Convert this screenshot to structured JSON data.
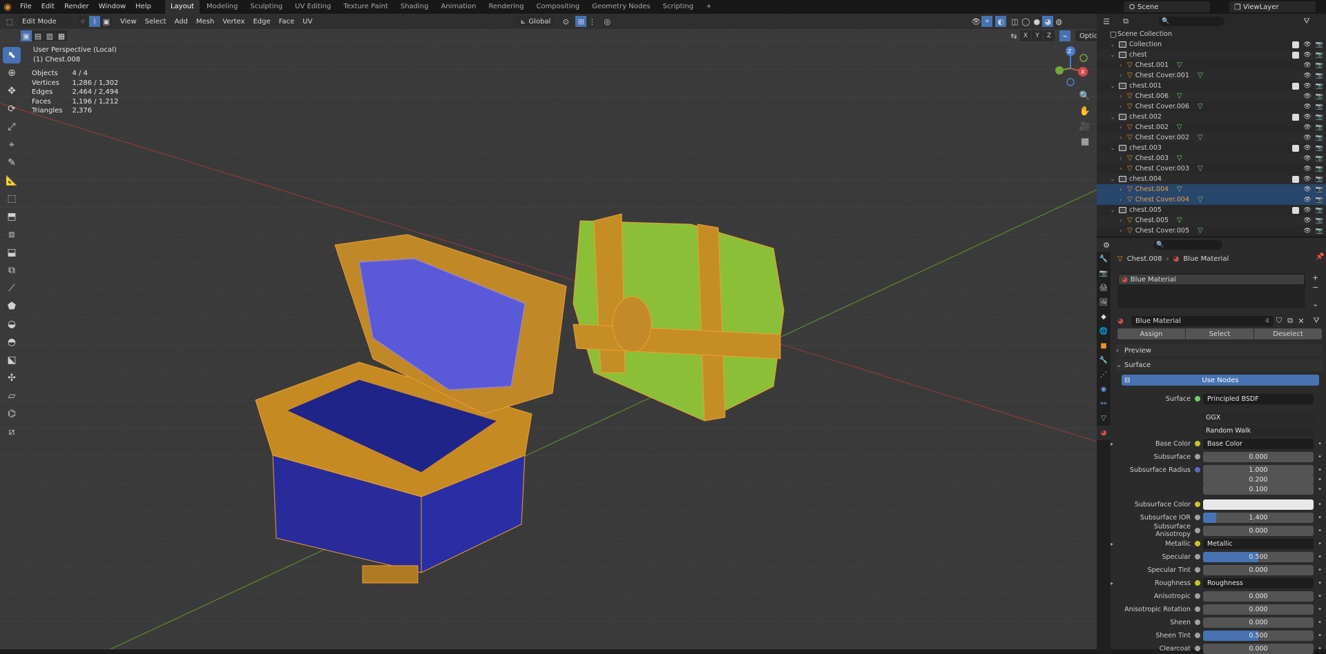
{
  "topbar": {
    "menus": [
      "File",
      "Edit",
      "Render",
      "Window",
      "Help"
    ],
    "workspaces": [
      "Layout",
      "Modeling",
      "Sculpting",
      "UV Editing",
      "Texture Paint",
      "Shading",
      "Animation",
      "Rendering",
      "Compositing",
      "Geometry Nodes",
      "Scripting"
    ],
    "active_workspace": "Layout",
    "add_tab": "+",
    "scene": "Scene",
    "view_layer": "ViewLayer"
  },
  "viewport_header": {
    "mode": "Edit Mode",
    "menus": [
      "View",
      "Select",
      "Add",
      "Mesh",
      "Vertex",
      "Edge",
      "Face",
      "UV"
    ],
    "orientation": "Global",
    "options": "Options",
    "axes": [
      "X",
      "Y",
      "Z"
    ]
  },
  "viewport": {
    "perspective": "User Perspective (Local)",
    "object": "(1) Chest.008",
    "stats": [
      {
        "label": "Objects",
        "value": "4 / 4"
      },
      {
        "label": "Vertices",
        "value": "1,286 / 1,302"
      },
      {
        "label": "Edges",
        "value": "2,464 / 2,494"
      },
      {
        "label": "Faces",
        "value": "1,196 / 1,212"
      },
      {
        "label": "Triangles",
        "value": "2,376"
      }
    ],
    "gizmo": {
      "x": "X",
      "y": "Y",
      "z": "Z"
    }
  },
  "outliner": {
    "root": "Scene Collection",
    "rows": [
      {
        "label": "Collection",
        "type": "collection",
        "indent": 1
      },
      {
        "label": "chest",
        "type": "collection",
        "indent": 1
      },
      {
        "label": "Chest.001",
        "type": "mesh",
        "indent": 2
      },
      {
        "label": "Chest Cover.001",
        "type": "mesh",
        "indent": 2
      },
      {
        "label": "chest.001",
        "type": "collection",
        "indent": 1
      },
      {
        "label": "Chest.006",
        "type": "mesh",
        "indent": 2
      },
      {
        "label": "Chest Cover.006",
        "type": "mesh",
        "indent": 2
      },
      {
        "label": "chest.002",
        "type": "collection",
        "indent": 1
      },
      {
        "label": "Chest.002",
        "type": "mesh",
        "indent": 2
      },
      {
        "label": "Chest Cover.002",
        "type": "mesh",
        "indent": 2
      },
      {
        "label": "chest.003",
        "type": "collection",
        "indent": 1
      },
      {
        "label": "Chest.003",
        "type": "mesh",
        "indent": 2
      },
      {
        "label": "Chest Cover.003",
        "type": "mesh",
        "indent": 2
      },
      {
        "label": "chest.004",
        "type": "collection",
        "indent": 1
      },
      {
        "label": "Chest.004",
        "type": "mesh",
        "indent": 2,
        "selected": true
      },
      {
        "label": "Chest Cover.004",
        "type": "mesh",
        "indent": 2,
        "selected": true
      },
      {
        "label": "chest.005",
        "type": "collection",
        "indent": 1
      },
      {
        "label": "Chest.005",
        "type": "mesh",
        "indent": 2
      },
      {
        "label": "Chest Cover.005",
        "type": "mesh",
        "indent": 2
      }
    ]
  },
  "properties": {
    "breadcrumb_object": "Chest.008",
    "breadcrumb_material": "Blue Material",
    "slot": "Blue Material",
    "material_name": "Blue Material",
    "users": "4",
    "assign": "Assign",
    "select": "Select",
    "deselect": "Deselect",
    "preview": "Preview",
    "surface_panel": "Surface",
    "use_nodes": "Use Nodes",
    "surface_label": "Surface",
    "surface_value": "Principled BSDF",
    "distribution": "GGX",
    "subsurface_method": "Random Walk",
    "rows": [
      {
        "label": "Base Color",
        "value": "Base Color",
        "kind": "link"
      },
      {
        "label": "Subsurface",
        "value": "0.000",
        "kind": "num",
        "fill": 0
      },
      {
        "label": "Subsurface Radius",
        "value": "1.000",
        "kind": "num",
        "fill": 0
      },
      {
        "label": "",
        "value": "0.200",
        "kind": "num",
        "fill": 0
      },
      {
        "label": "",
        "value": "0.100",
        "kind": "num",
        "fill": 0
      },
      {
        "label": "Subsurface Color",
        "value": "",
        "kind": "color"
      },
      {
        "label": "Subsurface IOR",
        "value": "1.400",
        "kind": "num",
        "fill": 0.12
      },
      {
        "label": "Subsurface Anisotropy",
        "value": "0.000",
        "kind": "num",
        "fill": 0
      },
      {
        "label": "Metallic",
        "value": "Metallic",
        "kind": "link"
      },
      {
        "label": "Specular",
        "value": "0.500",
        "kind": "num",
        "fill": 0.5
      },
      {
        "label": "Specular Tint",
        "value": "0.000",
        "kind": "num",
        "fill": 0
      },
      {
        "label": "Roughness",
        "value": "Roughness",
        "kind": "link"
      },
      {
        "label": "Anisotropic",
        "value": "0.000",
        "kind": "num",
        "fill": 0
      },
      {
        "label": "Anisotropic Rotation",
        "value": "0.000",
        "kind": "num",
        "fill": 0
      },
      {
        "label": "Sheen",
        "value": "0.000",
        "kind": "num",
        "fill": 0
      },
      {
        "label": "Sheen Tint",
        "value": "0.500",
        "kind": "num",
        "fill": 0.5
      },
      {
        "label": "Clearcoat",
        "value": "0.000",
        "kind": "num",
        "fill": 0
      }
    ]
  },
  "colors": {
    "accent": "#4772b3",
    "selection": "#e8922d",
    "gold": "#d59a2a",
    "blue": "#2a2fa8",
    "green": "#86b933"
  }
}
